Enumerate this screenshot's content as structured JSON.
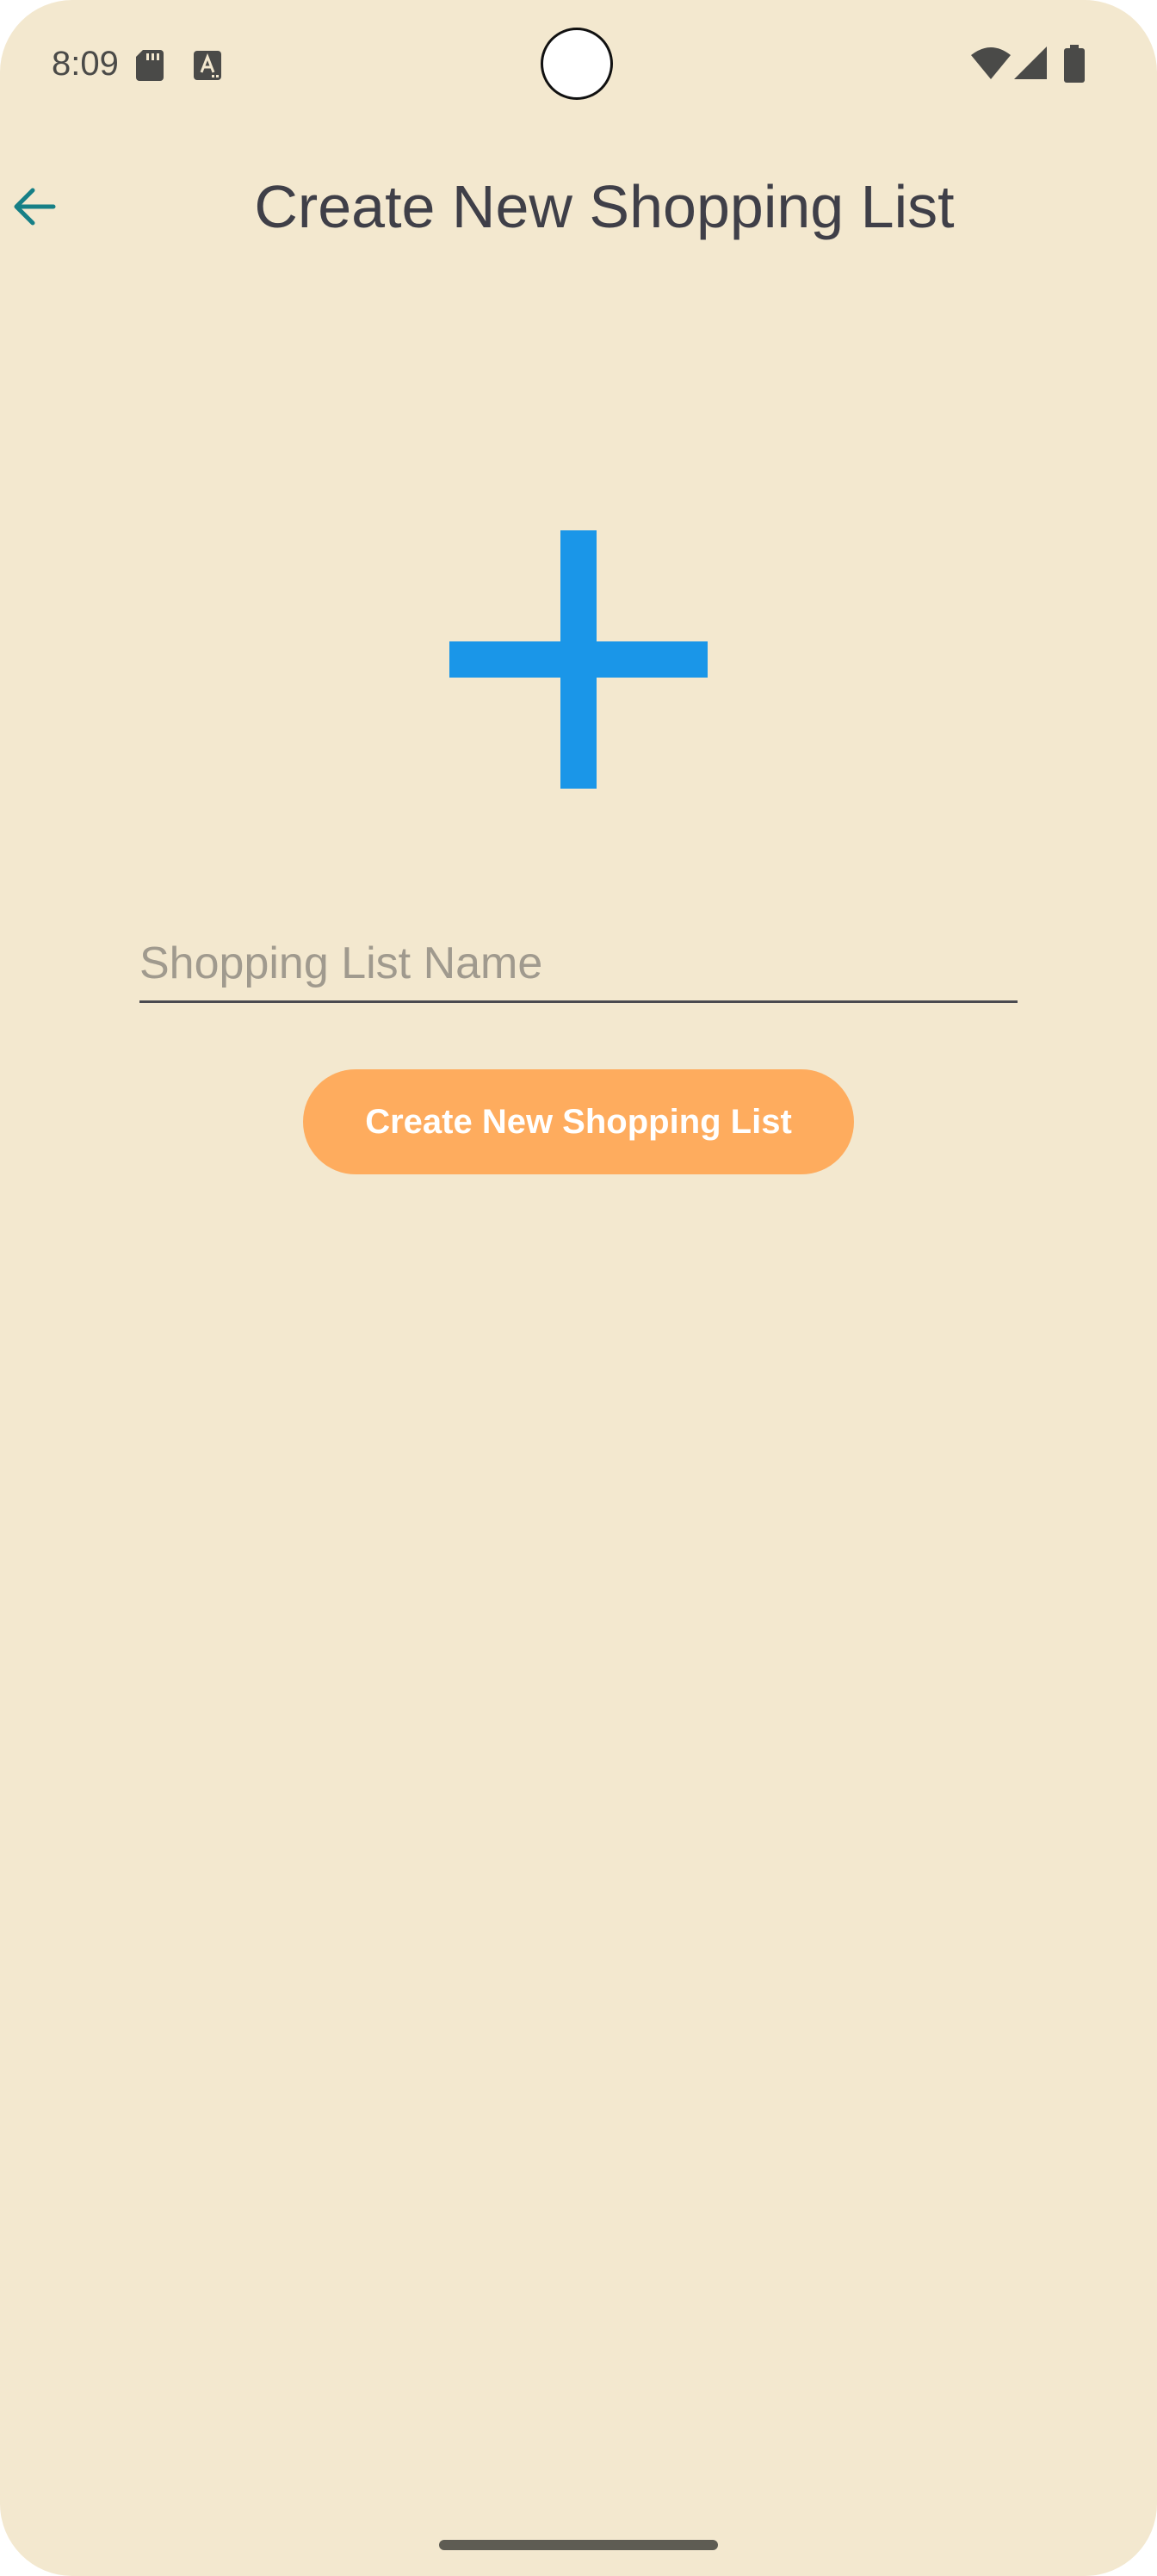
{
  "status_bar": {
    "time": "8:09",
    "icons": [
      "sd-card-icon",
      "text-a-icon",
      "wifi-icon",
      "cell-signal-icon",
      "battery-icon"
    ]
  },
  "app_bar": {
    "back_icon": "arrow-back-icon",
    "title": "Create New Shopping List"
  },
  "illustration": {
    "icon": "plus-icon",
    "color": "#1A96E8"
  },
  "form": {
    "name_input": {
      "value": "",
      "placeholder": "Shopping List Name"
    },
    "submit_label": "Create New Shopping List"
  },
  "colors": {
    "background": "#F3E8CF",
    "accent_button": "#FEAC5E",
    "back_arrow": "#167F86",
    "title_text": "#3F3F48"
  }
}
